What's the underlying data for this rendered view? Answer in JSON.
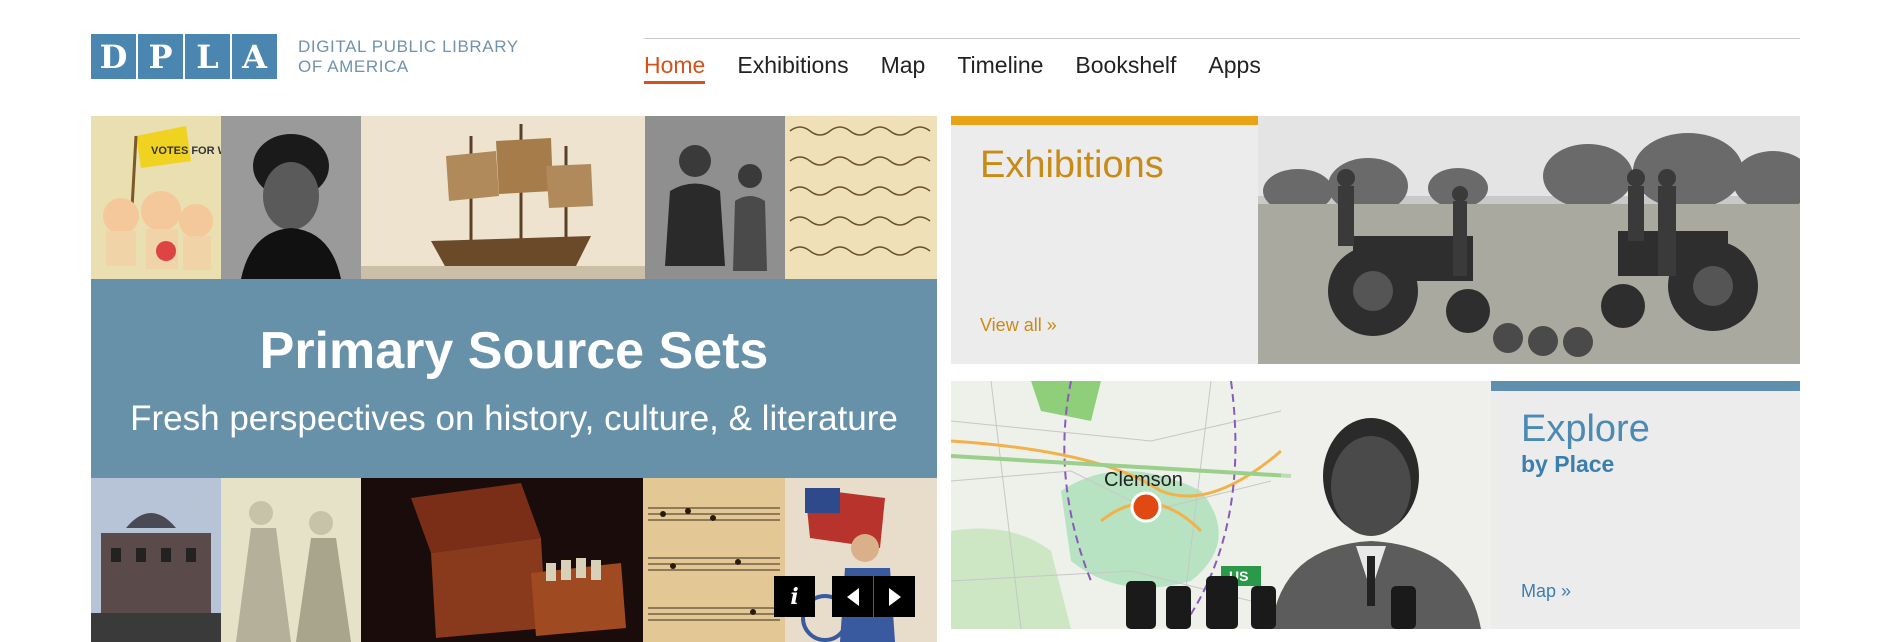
{
  "logo": {
    "letters": [
      "D",
      "P",
      "L",
      "A"
    ],
    "tagline_line1": "DIGITAL PUBLIC LIBRARY",
    "tagline_line2": "OF AMERICA",
    "color": "#4a86b0"
  },
  "nav": {
    "items": [
      {
        "label": "Home",
        "active": true
      },
      {
        "label": "Exhibitions",
        "active": false
      },
      {
        "label": "Map",
        "active": false
      },
      {
        "label": "Timeline",
        "active": false
      },
      {
        "label": "Bookshelf",
        "active": false
      },
      {
        "label": "Apps",
        "active": false
      }
    ],
    "active_color": "#d4531a"
  },
  "hero": {
    "title": "Primary Source Sets",
    "subtitle": "Fresh perspectives on history, culture, & literature",
    "band_color": "#6790a9",
    "controls": {
      "info": "i",
      "prev_icon": "triangle-left-icon",
      "next_icon": "triangle-right-icon"
    },
    "tag_text": "VOTES FOR WOMEN"
  },
  "exhibitions_card": {
    "title": "Exhibitions",
    "link": "View all »",
    "accent_color": "#e8a317"
  },
  "explore_card": {
    "title": "Explore",
    "subtitle": "by Place",
    "link": "Map »",
    "map_label": "Clemson",
    "road_label": "US",
    "accent_color": "#5f8fae"
  }
}
